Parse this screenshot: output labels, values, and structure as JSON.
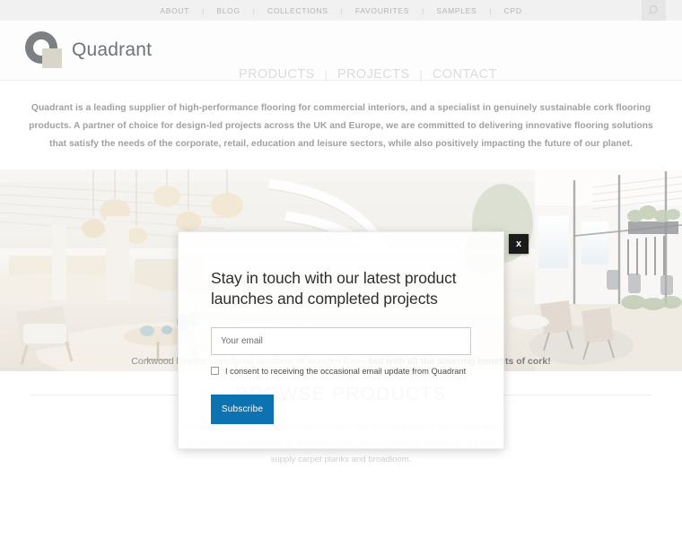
{
  "topbar": {
    "links": [
      "ABOUT",
      "BLOG",
      "COLLECTIONS",
      "FAVOURITES",
      "SAMPLES",
      "CPD"
    ],
    "separator": "|",
    "search_icon": "search-icon"
  },
  "header": {
    "brand_name": "Quadrant",
    "logo_icon": "quadrant-logo-icon",
    "nav": [
      "PRODUCTS",
      "PROJECTS",
      "CONTACT"
    ],
    "nav_separator": "|"
  },
  "intro": {
    "text": "Quadrant is a leading supplier of high-performance flooring for commercial interiors, and a specialist in genuinely sustainable cork flooring products. A partner of choice for design-led projects across the UK and Europe, we are committed to delivering innovative flooring solutions that satisfy the needs of the corporate, retail, education and leisure sectors, while also positively impacting the future of our planet."
  },
  "hero": {
    "caption_lead": "Corkwood has the reassuring aesthetic of wooden floors ",
    "caption_bold": "but with all the amazing benefits of cork!",
    "prev_icon": "chevron-left-icon",
    "next_icon": "chevron-right-icon"
  },
  "browse": {
    "title": "BROWSE PRODUCTS",
    "subtitle": "Our products combine modern, eye-catching and functional design with outstanding environmental credentials. In addition to our core cork flooring collections, we also supply carpet planks and broadloom."
  },
  "modal": {
    "close_label": "x",
    "close_icon": "close-icon",
    "title": "Stay in touch with our latest product launches and completed projects",
    "email_placeholder": "Your email",
    "email_value": "",
    "consent_label": "I consent to receiving the occasional email update from Quadrant",
    "subscribe_label": "Subscribe",
    "accent_color": "#0c72b0"
  }
}
